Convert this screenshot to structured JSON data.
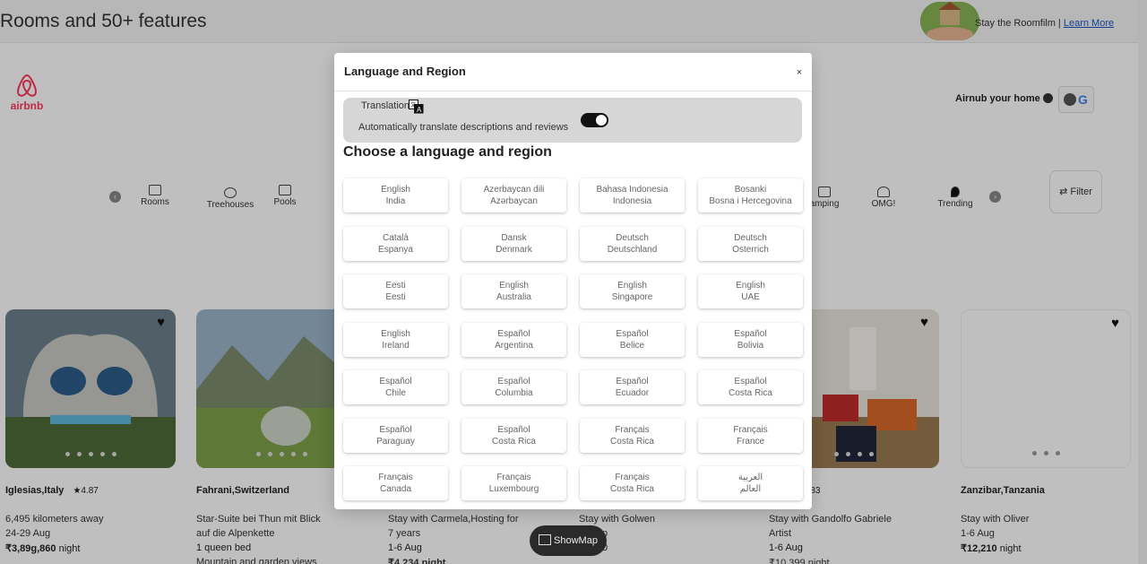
{
  "banner": {
    "title": "Rooms and 50+ features",
    "promo_text": "Stay the Roomfilm | ",
    "promo_link": "Learn More"
  },
  "header": {
    "logo_text": "airbnb",
    "host_link": "Airnub your home",
    "google_glyph": "G"
  },
  "categories": {
    "items": [
      {
        "label": "Rooms",
        "icon": "rooms-icon"
      },
      {
        "label": "Treehouses",
        "icon": "treehouse-icon"
      },
      {
        "label": "Pools",
        "icon": "pool-icon"
      },
      {
        "label": "amping",
        "icon": "camping-icon"
      },
      {
        "label": "OMG!",
        "icon": "ufo-icon"
      },
      {
        "label": "Trending",
        "icon": "flame-icon"
      }
    ],
    "filter_label": "⇄ Filter"
  },
  "listings": [
    {
      "place": "Iglesias,Italy",
      "rating": "★4.87",
      "l1": "6,495 kilometers away",
      "l2": "24-29 Aug",
      "price": "₹3,89g,860",
      "price_suffix": " night",
      "l4": ""
    },
    {
      "place": "Fahrani,Switzerland",
      "rating": "",
      "l1": "Star-Suite bei Thun mit Blick",
      "l2": "auf die Alpenkette",
      "price": "",
      "price_suffix": "1 queen bed",
      "l4": "Mountain and garden views"
    },
    {
      "place": "",
      "rating": "",
      "l1": "Stay with Carmela,Hosting for",
      "l2": "7 years",
      "price": "",
      "price_suffix": "1-6 Aug",
      "l4": "₹4,234 night"
    },
    {
      "place": "",
      "rating": "",
      "l1": "Stay with Golwen",
      "l2": "p",
      "price": "",
      "price_suffix": "0",
      "l4": ""
    },
    {
      "place": "taly",
      "rating": "★4.83",
      "l1": "Stay with Gandolfo Gabriele",
      "l2": "Artist",
      "price": "",
      "price_suffix": "1-6 Aug",
      "l4": "₹10,399 night"
    },
    {
      "place": "Zanzibar,Tanzania",
      "rating": "",
      "l1": "Stay with Oliver",
      "l2": "1-6 Aug",
      "price": "₹12,210",
      "price_suffix": " night",
      "l4": ""
    }
  ],
  "showmap_label": "ShowMap",
  "modal": {
    "title": "Language and Region",
    "close_label": "×",
    "translation_label": "Translation",
    "translation_desc": "Automatically translate descriptions and reviews",
    "translation_enabled": true,
    "heading": "Choose a language and region",
    "languages": [
      {
        "lang": "English",
        "region": "India"
      },
      {
        "lang": "Azerbaycan dili",
        "region": "Azərbaycan"
      },
      {
        "lang": "Bahasa Indonesia",
        "region": "Indonesia"
      },
      {
        "lang": "Bosanki",
        "region": "Bosna i Hercegovina"
      },
      {
        "lang": "Català",
        "region": "Espanya"
      },
      {
        "lang": "Dansk",
        "region": "Denmark"
      },
      {
        "lang": "Deutsch",
        "region": "Deutschland"
      },
      {
        "lang": "Deutsch",
        "region": "Osterrich"
      },
      {
        "lang": "Eesti",
        "region": "Eesti"
      },
      {
        "lang": "English",
        "region": "Australia"
      },
      {
        "lang": "English",
        "region": "Singapore"
      },
      {
        "lang": "English",
        "region": "UAE"
      },
      {
        "lang": "English",
        "region": "Ireland"
      },
      {
        "lang": "Español",
        "region": "Argentina"
      },
      {
        "lang": "Español",
        "region": "Belice"
      },
      {
        "lang": "Español",
        "region": "Bolivia"
      },
      {
        "lang": "Español",
        "region": "Chile"
      },
      {
        "lang": "Español",
        "region": "Columbia"
      },
      {
        "lang": "Español",
        "region": "Ecuador"
      },
      {
        "lang": "Español",
        "region": "Costa Rica"
      },
      {
        "lang": "Español",
        "region": "Paraguay"
      },
      {
        "lang": "Español",
        "region": "Costa Rica"
      },
      {
        "lang": "Français",
        "region": "Costa Rica"
      },
      {
        "lang": "Français",
        "region": "France"
      },
      {
        "lang": "Français",
        "region": "Canada"
      },
      {
        "lang": "Français",
        "region": "Luxembourg"
      },
      {
        "lang": "Français",
        "region": "Costa Rica"
      },
      {
        "lang": "العربية",
        "region": "العالم"
      }
    ]
  },
  "colors": {
    "brand": "#ff385c",
    "link": "#1a55c4",
    "toggle_on": "#111111",
    "translation_box": "#d6d6d6"
  }
}
